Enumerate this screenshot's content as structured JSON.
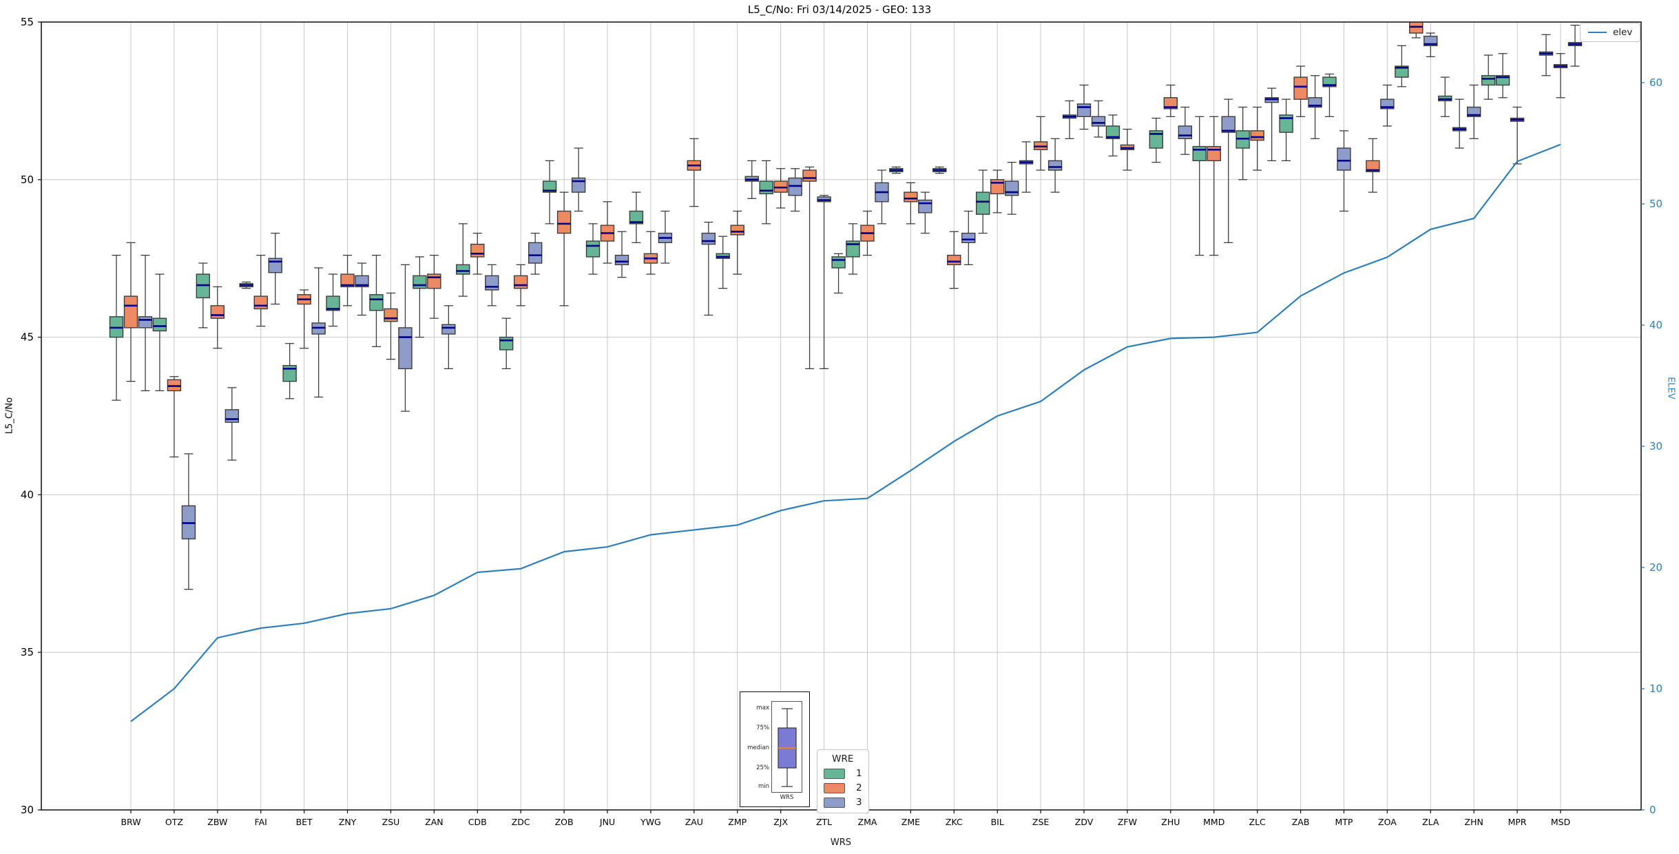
{
  "title": "L5_C/No: Fri 03/14/2025 - GEO: 133",
  "colors": {
    "wre1": "#66b596",
    "wre2": "#ed8a63",
    "wre3": "#8d9cc8",
    "median": "#00008b",
    "box_edge": "#3d3d3d",
    "whisker": "#3d3d3d",
    "grid": "#c8c8c8",
    "spine": "#1a1a1a",
    "elev_line": "#2e7ebc",
    "right_axis_text": "#2e7ebc",
    "inset_box_fill": "#7b7bd6",
    "inset_median": "#e0813c"
  },
  "legend_elev": {
    "label": "elev"
  },
  "legend_wre": {
    "title": "WRE",
    "entries": [
      {
        "label": "1",
        "color": "#66b596"
      },
      {
        "label": "2",
        "color": "#ed8a63"
      },
      {
        "label": "3",
        "color": "#8d9cc8"
      }
    ]
  },
  "inset": {
    "labels": [
      "max",
      "75%",
      "median",
      "25%",
      "min"
    ],
    "xlabel": "WRS"
  },
  "chart_data": {
    "type": "boxplot+line",
    "title": "L5_C/No: Fri 03/14/2025 - GEO: 133",
    "xlabel": "WRS",
    "ylabel_left": "L5_C/No",
    "ylabel_right": "ELEV",
    "ylim_left": [
      30,
      55
    ],
    "ylim_right": [
      0,
      65
    ],
    "yticks_left": [
      30,
      35,
      40,
      45,
      50,
      55
    ],
    "yticks_right": [
      0,
      10,
      20,
      30,
      40,
      50,
      60
    ],
    "grid": true,
    "hue_title": "WRE",
    "hue_levels": [
      {
        "wre": 1,
        "color": "#66b596"
      },
      {
        "wre": 2,
        "color": "#ed8a63"
      },
      {
        "wre": 3,
        "color": "#8d9cc8"
      }
    ],
    "line_series": {
      "name": "elev",
      "axis": "right",
      "color": "#2e7ebc"
    },
    "box_format": [
      "wre",
      "slot",
      "whislo",
      "q1",
      "med",
      "q3",
      "whishi"
    ],
    "stations": [
      {
        "name": "BRW",
        "elev": 7.3,
        "boxes": [
          [
            1,
            -1,
            43.0,
            45.0,
            45.3,
            45.65,
            47.6
          ],
          [
            2,
            0,
            43.6,
            45.3,
            46.0,
            46.3,
            48.0
          ],
          [
            3,
            1,
            43.3,
            45.3,
            45.55,
            45.65,
            47.6
          ]
        ]
      },
      {
        "name": "OTZ",
        "elev": 10.0,
        "boxes": [
          [
            1,
            -1,
            43.3,
            45.2,
            45.35,
            45.6,
            47.0
          ],
          [
            2,
            0,
            41.2,
            43.3,
            43.45,
            43.65,
            43.75
          ],
          [
            3,
            1,
            37.0,
            38.6,
            39.1,
            39.65,
            41.3
          ]
        ]
      },
      {
        "name": "ZBW",
        "elev": 14.2,
        "boxes": [
          [
            1,
            -1,
            45.3,
            46.25,
            46.65,
            47.0,
            47.35
          ],
          [
            2,
            0,
            44.65,
            45.6,
            45.7,
            46.0,
            46.6
          ],
          [
            3,
            1,
            41.1,
            42.3,
            42.4,
            42.7,
            43.4
          ]
        ]
      },
      {
        "name": "FAI",
        "elev": 15.0,
        "boxes": [
          [
            1,
            -1,
            46.55,
            46.6,
            46.65,
            46.7,
            46.75
          ],
          [
            2,
            0,
            45.35,
            45.9,
            46.0,
            46.3,
            47.6
          ],
          [
            3,
            1,
            46.05,
            47.05,
            47.4,
            47.5,
            48.3
          ]
        ]
      },
      {
        "name": "BET",
        "elev": 15.4,
        "boxes": [
          [
            1,
            -1,
            43.05,
            43.6,
            44.0,
            44.1,
            44.8
          ],
          [
            2,
            0,
            44.65,
            46.05,
            46.2,
            46.35,
            46.5
          ],
          [
            3,
            1,
            43.1,
            45.1,
            45.3,
            45.45,
            47.2
          ]
        ]
      },
      {
        "name": "ZNY",
        "elev": 16.2,
        "boxes": [
          [
            1,
            -1,
            45.35,
            45.85,
            45.9,
            46.3,
            47.0
          ],
          [
            2,
            0,
            46.0,
            46.6,
            46.65,
            47.0,
            47.6
          ],
          [
            3,
            1,
            45.7,
            46.6,
            46.65,
            46.95,
            47.35
          ]
        ]
      },
      {
        "name": "ZSU",
        "elev": 16.6,
        "boxes": [
          [
            1,
            -1,
            44.7,
            45.85,
            46.2,
            46.35,
            47.6
          ],
          [
            2,
            0,
            44.3,
            45.5,
            45.6,
            45.9,
            46.4
          ],
          [
            3,
            1,
            42.65,
            44.0,
            45.0,
            45.3,
            47.3
          ]
        ]
      },
      {
        "name": "ZAN",
        "elev": 17.7,
        "boxes": [
          [
            1,
            -1,
            45.0,
            46.55,
            46.65,
            46.95,
            47.55
          ],
          [
            2,
            0,
            45.6,
            46.55,
            46.9,
            47.0,
            47.6
          ],
          [
            3,
            1,
            44.0,
            45.1,
            45.3,
            45.4,
            46.0
          ]
        ]
      },
      {
        "name": "CDB",
        "elev": 19.6,
        "boxes": [
          [
            1,
            -1,
            46.3,
            47.0,
            47.1,
            47.3,
            48.6
          ],
          [
            2,
            0,
            47.0,
            47.55,
            47.65,
            47.95,
            48.3
          ],
          [
            3,
            1,
            46.0,
            46.5,
            46.6,
            46.95,
            47.3
          ]
        ]
      },
      {
        "name": "ZDC",
        "elev": 19.9,
        "boxes": [
          [
            1,
            -1,
            44.0,
            44.6,
            44.9,
            45.0,
            45.6
          ],
          [
            2,
            0,
            46.0,
            46.55,
            46.65,
            46.95,
            47.3
          ],
          [
            3,
            1,
            47.0,
            47.35,
            47.6,
            48.0,
            48.3
          ]
        ]
      },
      {
        "name": "ZOB",
        "elev": 21.3,
        "boxes": [
          [
            1,
            -1,
            48.6,
            49.6,
            49.65,
            49.95,
            50.6
          ],
          [
            2,
            0,
            46.0,
            48.3,
            48.6,
            49.0,
            49.6
          ],
          [
            3,
            1,
            49.0,
            49.6,
            49.95,
            50.05,
            51.0
          ]
        ]
      },
      {
        "name": "JNU",
        "elev": 21.7,
        "boxes": [
          [
            1,
            -1,
            47.0,
            47.55,
            47.9,
            48.05,
            48.6
          ],
          [
            2,
            0,
            47.35,
            48.05,
            48.3,
            48.55,
            49.3
          ],
          [
            3,
            1,
            46.9,
            47.3,
            47.4,
            47.6,
            48.35
          ]
        ]
      },
      {
        "name": "YWG",
        "elev": 22.7,
        "boxes": [
          [
            1,
            -1,
            48.0,
            48.6,
            48.65,
            49.0,
            49.6
          ],
          [
            2,
            0,
            47.0,
            47.35,
            47.5,
            47.65,
            48.35
          ],
          [
            3,
            1,
            47.35,
            48.0,
            48.15,
            48.3,
            49.0
          ]
        ]
      },
      {
        "name": "ZAU",
        "elev": 23.1,
        "boxes": [
          [
            2,
            0,
            49.15,
            50.3,
            50.45,
            50.6,
            51.3
          ],
          [
            3,
            1,
            45.7,
            47.95,
            48.05,
            48.3,
            48.65
          ]
        ]
      },
      {
        "name": "ZMP",
        "elev": 23.5,
        "boxes": [
          [
            1,
            -1,
            46.55,
            47.5,
            47.55,
            47.65,
            48.2
          ],
          [
            2,
            0,
            47.0,
            48.25,
            48.35,
            48.55,
            49.0
          ],
          [
            3,
            1,
            49.4,
            49.95,
            50.0,
            50.1,
            50.6
          ]
        ]
      },
      {
        "name": "ZJX",
        "elev": 24.7,
        "boxes": [
          [
            1,
            -1,
            48.6,
            49.55,
            49.65,
            49.95,
            50.6
          ],
          [
            2,
            0,
            49.1,
            49.6,
            49.75,
            49.95,
            50.35
          ],
          [
            3,
            1,
            49.0,
            49.5,
            49.8,
            50.05,
            50.35
          ]
        ]
      },
      {
        "name": "ZTL",
        "elev": 25.5,
        "boxes": [
          [
            2,
            -1,
            44.0,
            49.95,
            50.05,
            50.3,
            50.4
          ],
          [
            3,
            0,
            44.0,
            49.3,
            49.35,
            49.45,
            49.5
          ],
          [
            1,
            1,
            46.4,
            47.2,
            47.45,
            47.55,
            47.65
          ]
        ]
      },
      {
        "name": "ZMA",
        "elev": 25.7,
        "boxes": [
          [
            1,
            -1,
            47.0,
            47.55,
            47.95,
            48.05,
            48.6
          ],
          [
            2,
            0,
            47.6,
            48.05,
            48.3,
            48.55,
            49.0
          ],
          [
            3,
            1,
            48.6,
            49.3,
            49.6,
            49.9,
            50.3
          ]
        ]
      },
      {
        "name": "ZME",
        "elev": 28.0,
        "boxes": [
          [
            1,
            -1,
            50.2,
            50.25,
            50.3,
            50.35,
            50.4
          ],
          [
            2,
            0,
            48.6,
            49.3,
            49.4,
            49.6,
            49.9
          ],
          [
            3,
            1,
            48.3,
            48.95,
            49.25,
            49.35,
            49.6
          ]
        ]
      },
      {
        "name": "ZKC",
        "elev": 30.4,
        "boxes": [
          [
            1,
            -1,
            50.2,
            50.25,
            50.3,
            50.35,
            50.4
          ],
          [
            2,
            0,
            46.55,
            47.3,
            47.4,
            47.6,
            48.35
          ],
          [
            3,
            1,
            47.3,
            48.0,
            48.1,
            48.3,
            49.0
          ]
        ]
      },
      {
        "name": "BIL",
        "elev": 32.5,
        "boxes": [
          [
            1,
            -1,
            48.3,
            48.9,
            49.3,
            49.6,
            50.3
          ],
          [
            2,
            0,
            48.95,
            49.55,
            49.9,
            50.0,
            50.3
          ],
          [
            3,
            1,
            48.9,
            49.5,
            49.6,
            49.95,
            50.55
          ]
        ]
      },
      {
        "name": "ZSE",
        "elev": 33.7,
        "boxes": [
          [
            1,
            -1,
            49.6,
            50.5,
            50.55,
            50.6,
            51.2
          ],
          [
            2,
            0,
            50.3,
            50.95,
            51.05,
            51.2,
            52.0
          ],
          [
            3,
            1,
            49.6,
            50.3,
            50.4,
            50.6,
            51.3
          ]
        ]
      },
      {
        "name": "ZDV",
        "elev": 36.3,
        "boxes": [
          [
            1,
            -1,
            51.3,
            51.95,
            52.0,
            52.05,
            52.5
          ],
          [
            3,
            0,
            51.6,
            52.0,
            52.3,
            52.4,
            53.0
          ],
          [
            3,
            1,
            51.35,
            51.7,
            51.8,
            52.0,
            52.5
          ]
        ]
      },
      {
        "name": "ZFW",
        "elev": 38.2,
        "boxes": [
          [
            1,
            -1,
            50.75,
            51.3,
            51.35,
            51.7,
            52.05
          ],
          [
            2,
            0,
            50.3,
            50.95,
            51.0,
            51.1,
            51.6
          ]
        ]
      },
      {
        "name": "ZHU",
        "elev": 38.9,
        "boxes": [
          [
            1,
            -1,
            50.55,
            51.0,
            51.45,
            51.55,
            51.95
          ],
          [
            2,
            0,
            52.0,
            52.25,
            52.3,
            52.6,
            53.0
          ],
          [
            3,
            1,
            50.8,
            51.3,
            51.4,
            51.7,
            52.3
          ]
        ]
      },
      {
        "name": "MMD",
        "elev": 39.0,
        "boxes": [
          [
            1,
            -1,
            47.6,
            50.6,
            50.95,
            51.05,
            52.0
          ],
          [
            2,
            0,
            47.6,
            50.6,
            50.95,
            51.05,
            52.0
          ],
          [
            3,
            1,
            48.0,
            51.5,
            51.55,
            52.0,
            52.55
          ]
        ]
      },
      {
        "name": "ZLC",
        "elev": 39.4,
        "boxes": [
          [
            1,
            -1,
            50.0,
            51.0,
            51.3,
            51.55,
            52.3
          ],
          [
            2,
            0,
            50.3,
            51.25,
            51.35,
            51.55,
            52.3
          ],
          [
            3,
            1,
            50.6,
            52.45,
            52.55,
            52.6,
            52.9
          ]
        ]
      },
      {
        "name": "ZAB",
        "elev": 42.4,
        "boxes": [
          [
            1,
            -1,
            50.6,
            51.5,
            51.95,
            52.05,
            52.55
          ],
          [
            2,
            0,
            52.0,
            52.55,
            52.95,
            53.25,
            53.6
          ],
          [
            3,
            1,
            51.3,
            52.3,
            52.35,
            52.6,
            53.3
          ]
        ]
      },
      {
        "name": "MTP",
        "elev": 44.3,
        "boxes": [
          [
            1,
            -1,
            52.0,
            52.95,
            53.0,
            53.25,
            53.35
          ],
          [
            3,
            0,
            49.0,
            50.3,
            50.6,
            51.0,
            51.55
          ]
        ]
      },
      {
        "name": "ZOA",
        "elev": 45.6,
        "boxes": [
          [
            2,
            -1,
            49.6,
            50.25,
            50.3,
            50.6,
            51.3
          ],
          [
            3,
            0,
            51.7,
            52.25,
            52.3,
            52.55,
            53.0
          ],
          [
            1,
            1,
            52.95,
            53.25,
            53.55,
            53.6,
            54.25
          ]
        ]
      },
      {
        "name": "ZLA",
        "elev": 47.9,
        "boxes": [
          [
            2,
            -1,
            54.5,
            54.65,
            54.85,
            55.1,
            55.15
          ],
          [
            3,
            0,
            53.9,
            54.25,
            54.3,
            54.55,
            54.65
          ],
          [
            1,
            1,
            52.0,
            52.5,
            52.55,
            52.65,
            53.25
          ]
        ]
      },
      {
        "name": "ZHN",
        "elev": 48.8,
        "boxes": [
          [
            1,
            -1,
            51.0,
            51.55,
            51.6,
            51.65,
            52.55
          ],
          [
            3,
            0,
            51.3,
            52.0,
            52.05,
            52.3,
            53.0
          ],
          [
            1,
            1,
            52.55,
            53.0,
            53.2,
            53.3,
            53.95
          ]
        ]
      },
      {
        "name": "MPR",
        "elev": 53.5,
        "boxes": [
          [
            1,
            -1,
            52.6,
            53.0,
            53.25,
            53.3,
            54.0
          ],
          [
            2,
            0,
            50.5,
            51.85,
            51.9,
            51.95,
            52.3
          ]
        ]
      },
      {
        "name": "MSD",
        "elev": 54.9,
        "boxes": [
          [
            1,
            -1,
            53.3,
            53.95,
            54.0,
            54.05,
            54.6
          ],
          [
            2,
            0,
            52.6,
            53.55,
            53.6,
            53.65,
            54.0
          ],
          [
            3,
            1,
            53.6,
            54.25,
            54.3,
            54.35,
            54.9
          ]
        ]
      }
    ]
  }
}
